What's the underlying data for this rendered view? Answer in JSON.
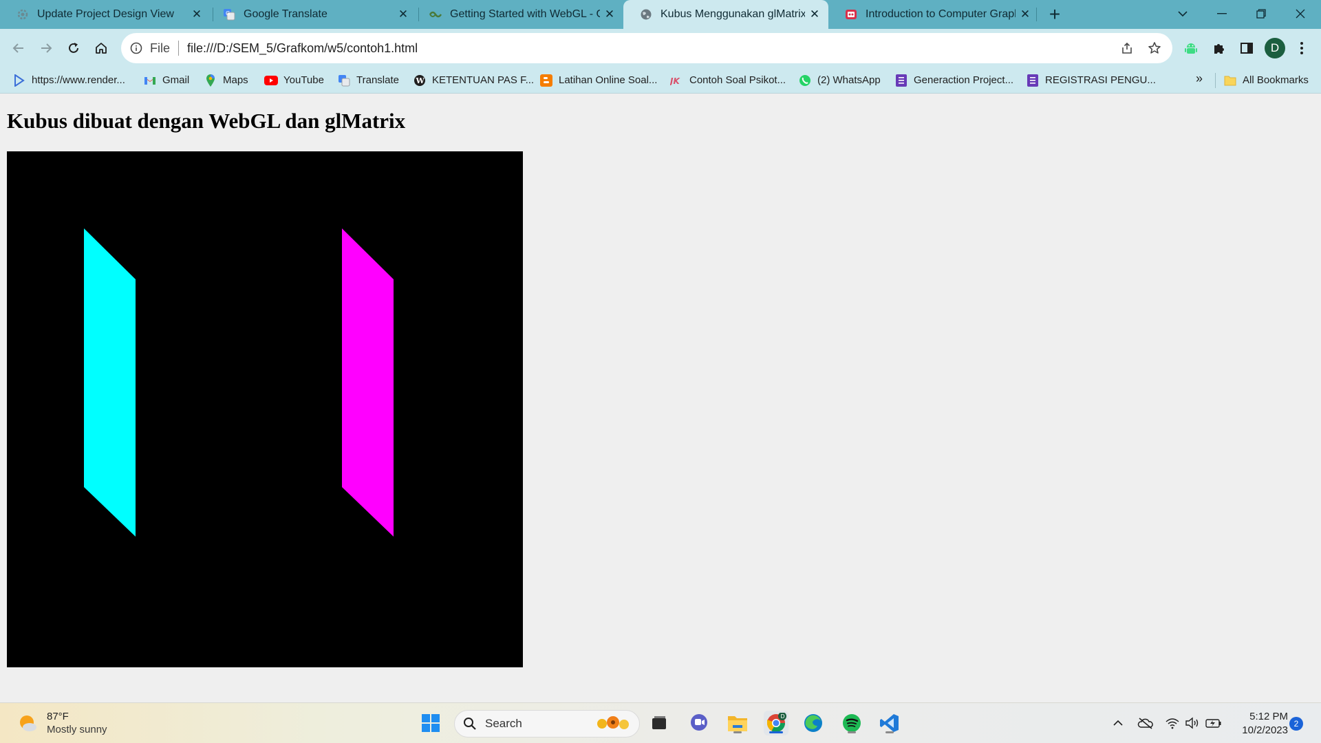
{
  "browser": {
    "tabs": [
      {
        "title": "Update Project Design View",
        "icon": "gear-icon"
      },
      {
        "title": "Google Translate",
        "icon": "translate-icon"
      },
      {
        "title": "Getting Started with WebGL - Gu",
        "icon": "webgl-icon"
      },
      {
        "title": "Kubus Menggunakan glMatrix d",
        "icon": "globe-icon"
      },
      {
        "title": "Introduction to Computer Graph",
        "icon": "slides-icon"
      }
    ],
    "active_tab": 3,
    "new_tab_label": "+",
    "close_label": "✕"
  },
  "toolbar": {
    "scheme_label": "File",
    "url": "file:///D:/SEM_5/Grafkom/w5/contoh1.html",
    "profile_initial": "D"
  },
  "bookmarks": {
    "items": [
      {
        "label": "https://www.render...",
        "icon": "render-icon"
      },
      {
        "label": "Gmail",
        "icon": "gmail-icon"
      },
      {
        "label": "Maps",
        "icon": "maps-icon"
      },
      {
        "label": "YouTube",
        "icon": "youtube-icon"
      },
      {
        "label": "Translate",
        "icon": "translate-icon"
      },
      {
        "label": "KETENTUAN PAS F...",
        "icon": "wordpress-icon"
      },
      {
        "label": "Latihan Online Soal...",
        "icon": "blogger-icon"
      },
      {
        "label": "Contoh Soal Psikot...",
        "icon": "psikotes-icon"
      },
      {
        "label": "(2) WhatsApp",
        "icon": "whatsapp-icon"
      },
      {
        "label": "Generaction Project...",
        "icon": "forms-icon"
      },
      {
        "label": "REGISTRASI PENGU...",
        "icon": "forms-icon"
      }
    ],
    "more_label": "»",
    "all_bookmarks_label": "All Bookmarks"
  },
  "page": {
    "heading": "Kubus dibuat dengan WebGL dan glMatrix",
    "canvas": {
      "background": "#000000",
      "faces": [
        {
          "name": "cyan-face",
          "color": "#00ffff"
        },
        {
          "name": "magenta-face",
          "color": "#ff00ff"
        }
      ]
    }
  },
  "taskbar": {
    "weather_temp": "87°F",
    "weather_condition": "Mostly sunny",
    "search_placeholder": "Search",
    "time": "5:12 PM",
    "date": "10/2/2023",
    "notification_count": "2"
  },
  "colors": {
    "tabstrip": "#5fb0c2",
    "active_tab": "#cde9ef",
    "page_background": "#efefef"
  }
}
